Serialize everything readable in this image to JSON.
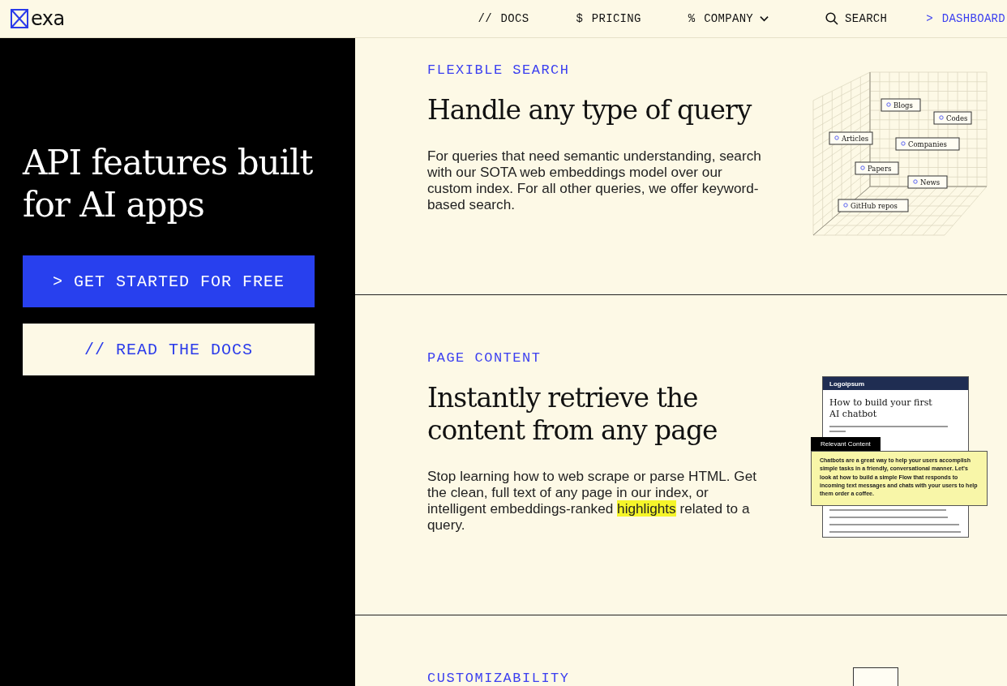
{
  "header": {
    "logo": "exa",
    "nav": [
      {
        "prefix": "//",
        "label": "DOCS",
        "kind": "text",
        "accent": false
      },
      {
        "prefix": "$",
        "label": "PRICING",
        "kind": "text",
        "accent": false
      },
      {
        "prefix": "%",
        "label": "COMPANY",
        "kind": "dropdown",
        "accent": false
      },
      {
        "label": "SEARCH",
        "kind": "search",
        "accent": false
      },
      {
        "prefix": ">",
        "label": "DASHBOARD",
        "kind": "text",
        "accent": true
      }
    ]
  },
  "hero": {
    "title": "API features built for AI apps",
    "buttons": [
      {
        "label": "> GET STARTED FOR FREE",
        "primary": true
      },
      {
        "label": "// READ THE DOCS",
        "primary": false
      }
    ]
  },
  "features": [
    {
      "label": "FLEXIBLE SEARCH",
      "title": "Handle any type of query",
      "illustration": {
        "kind": "query_grid",
        "tags": [
          "Blogs",
          "Codes",
          "Articles",
          "Companies",
          "Papers",
          "News",
          "GitHub repos"
        ]
      },
      "body": [
        {
          "text": "For queries that need semantic understanding, search with our SOTA web embeddings model over our custom index. For all other queries, we offer keyword-based search.",
          "highlight": false
        }
      ]
    },
    {
      "label": "PAGE CONTENT",
      "title": "Instantly retrieve the content from any page",
      "illustration": {
        "kind": "page_content",
        "brand": "Logoipsum",
        "heading": "How to build your first AI chatbot",
        "tag": "Relevant Content",
        "excerpt": "Chatbots are a great way to help your users accomplish simple tasks in a friendly, conversational manner. Let's look at how to build a simple Flow that responds to incoming text messages and chats with your users to help them order a coffee."
      },
      "body": [
        {
          "text": "Stop learning how to web scrape or parse HTML. Get the clean, full text of any page in our index, or intelligent embeddings-ranked ",
          "highlight": false
        },
        {
          "text": "highlights",
          "highlight": true
        },
        {
          "text": " related to a query.",
          "highlight": false
        }
      ]
    },
    {
      "label": "CUSTOMIZABILITY",
      "illustration": {
        "kind": "custom"
      }
    }
  ]
}
